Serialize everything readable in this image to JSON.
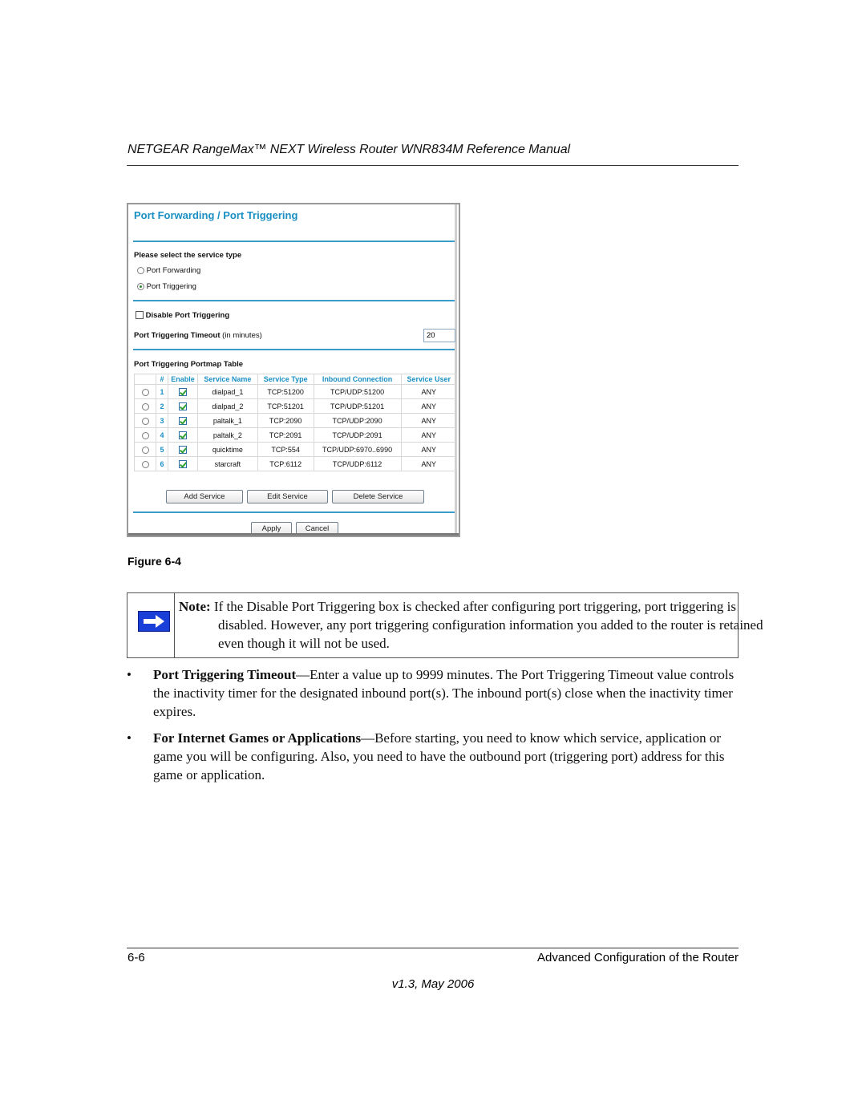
{
  "header": {
    "title": "NETGEAR RangeMax™ NEXT Wireless Router WNR834M Reference Manual"
  },
  "screenshot": {
    "title": "Port Forwarding / Port Triggering",
    "service_type_label": "Please select the service type",
    "service_types": [
      {
        "label": "Port Forwarding",
        "selected": false
      },
      {
        "label": "Port Triggering",
        "selected": true
      }
    ],
    "disable_label": "Disable Port Triggering",
    "disable_checked": false,
    "timeout_label_bold": "Port Triggering Timeout",
    "timeout_label_rest": " (in minutes)",
    "timeout_value": "20",
    "table_title": "Port Triggering Portmap Table",
    "table_headers": [
      "",
      "#",
      "Enable",
      "Service Name",
      "Service Type",
      "Inbound Connection",
      "Service User"
    ],
    "rows": [
      {
        "num": "1",
        "enabled": true,
        "name": "dialpad_1",
        "type": "TCP:51200",
        "inbound": "TCP/UDP:51200",
        "user": "ANY"
      },
      {
        "num": "2",
        "enabled": true,
        "name": "dialpad_2",
        "type": "TCP:51201",
        "inbound": "TCP/UDP:51201",
        "user": "ANY"
      },
      {
        "num": "3",
        "enabled": true,
        "name": "paltalk_1",
        "type": "TCP:2090",
        "inbound": "TCP/UDP:2090",
        "user": "ANY"
      },
      {
        "num": "4",
        "enabled": true,
        "name": "paltalk_2",
        "type": "TCP:2091",
        "inbound": "TCP/UDP:2091",
        "user": "ANY"
      },
      {
        "num": "5",
        "enabled": true,
        "name": "quicktime",
        "type": "TCP:554",
        "inbound": "TCP/UDP:6970..6990",
        "user": "ANY"
      },
      {
        "num": "6",
        "enabled": true,
        "name": "starcraft",
        "type": "TCP:6112",
        "inbound": "TCP/UDP:6112",
        "user": "ANY"
      }
    ],
    "buttons": {
      "add": "Add Service",
      "edit": "Edit Service",
      "delete": "Delete Service",
      "apply": "Apply",
      "cancel": "Cancel"
    },
    "colors": {
      "accent": "#1a8fc4",
      "rule": "#3a9cc8"
    }
  },
  "figure_label": "Figure 6-4",
  "note": {
    "lead": "Note:",
    "text": " If the Disable Port Triggering box is checked after configuring port triggering, port triggering is disabled. However, any port triggering configuration information you added to the router is retained even though it will not be used."
  },
  "bullets": [
    {
      "bold": "Port Triggering Timeout",
      "text": "—Enter a value up to 9999 minutes. The Port Triggering Timeout value controls the inactivity timer for the designated inbound port(s). The inbound port(s) close when the inactivity timer expires."
    },
    {
      "bold": "For Internet Games or Applications",
      "text": "—Before starting, you need to know which service, application or game you will be configuring. Also, you need to have the outbound port (triggering port) address for this game or application."
    }
  ],
  "footer": {
    "page": "6-6",
    "section": "Advanced Configuration of the Router",
    "version": "v1.3, May 2006"
  }
}
